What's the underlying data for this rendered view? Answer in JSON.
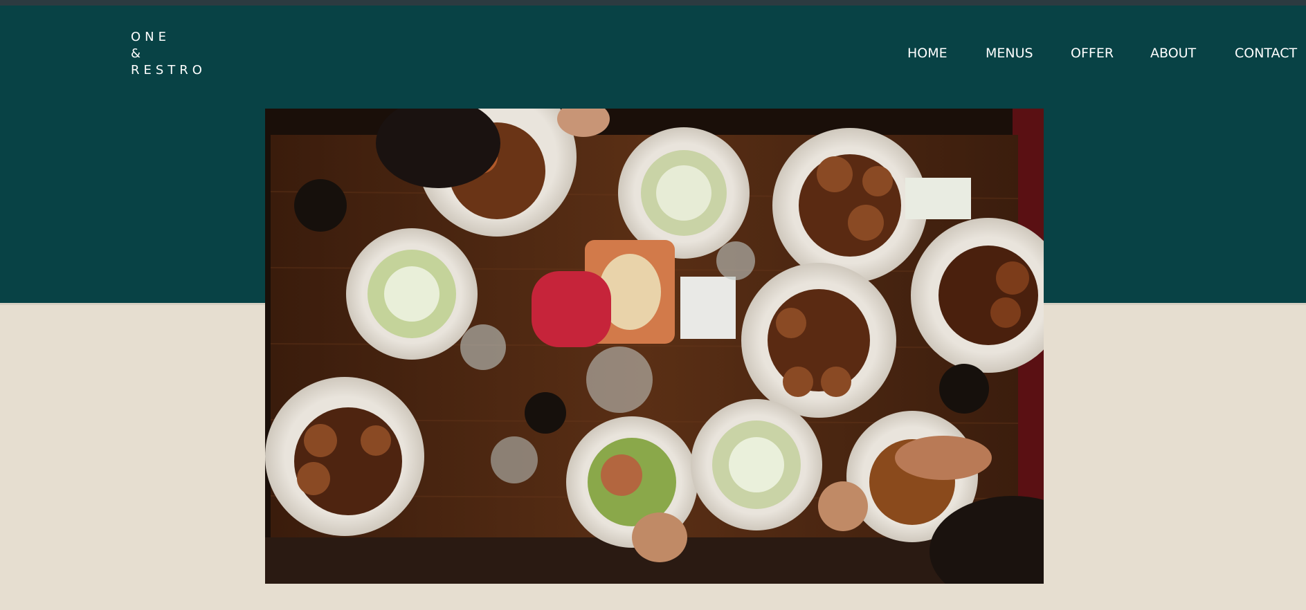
{
  "brand": {
    "logo_lines": [
      "ONE",
      "&",
      "RESTRO"
    ]
  },
  "nav": {
    "items": [
      "HOME",
      "MENUS",
      "OFFER",
      "ABOUT",
      "CONTACT"
    ]
  },
  "colors": {
    "header_band": "#084245",
    "page_background": "#e6ded0",
    "nav_text": "#ffffff",
    "top_strip": "#2c3a40"
  }
}
